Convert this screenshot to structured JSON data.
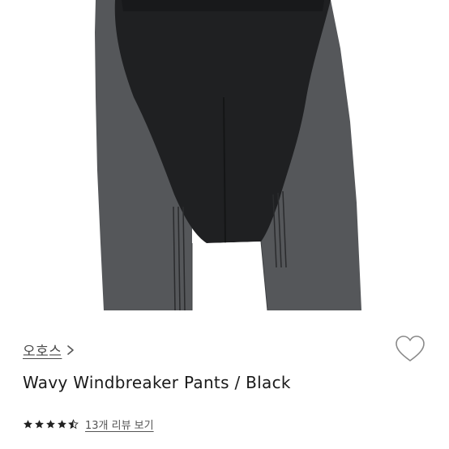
{
  "product": {
    "brand": "오호스",
    "title": "Wavy Windbreaker Pants / Black",
    "rating": 4.5,
    "rating_max": 5,
    "review_link": "13개 리뷰 보기"
  },
  "colors": {
    "pants_black": "#1f2022",
    "pants_gray": "#55575a",
    "text_dark": "#1a1a1a",
    "text_muted": "#555555",
    "star": "#222222"
  },
  "icons": {
    "brand_chevron": "chevron-right-icon",
    "wishlist": "heart-outline-icon",
    "star": "star-icon"
  }
}
